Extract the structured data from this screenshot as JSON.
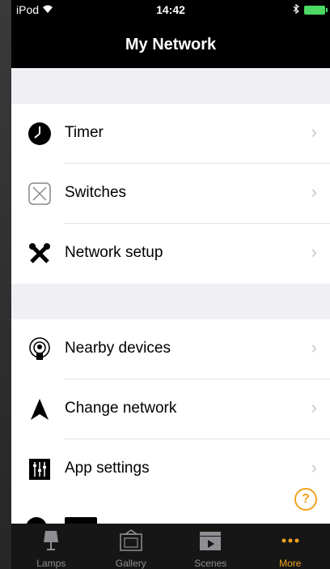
{
  "status": {
    "carrier": "iPod",
    "time": "14:42"
  },
  "navbar": {
    "title": "My Network"
  },
  "group1": [
    {
      "label": "Timer",
      "icon": "clock-icon"
    },
    {
      "label": "Switches",
      "icon": "switch-icon"
    },
    {
      "label": "Network setup",
      "icon": "tools-icon"
    }
  ],
  "group2": [
    {
      "label": "Nearby devices",
      "icon": "nearby-icon"
    },
    {
      "label": "Change network",
      "icon": "arrow-up-icon"
    },
    {
      "label": "App settings",
      "icon": "sliders-icon"
    }
  ],
  "help": {
    "label": "?"
  },
  "tabs": [
    {
      "label": "Lamps"
    },
    {
      "label": "Gallery"
    },
    {
      "label": "Scenes"
    },
    {
      "label": "More"
    }
  ],
  "colors": {
    "accent": "#f1a31e",
    "chevron": "#c7c7cc"
  }
}
